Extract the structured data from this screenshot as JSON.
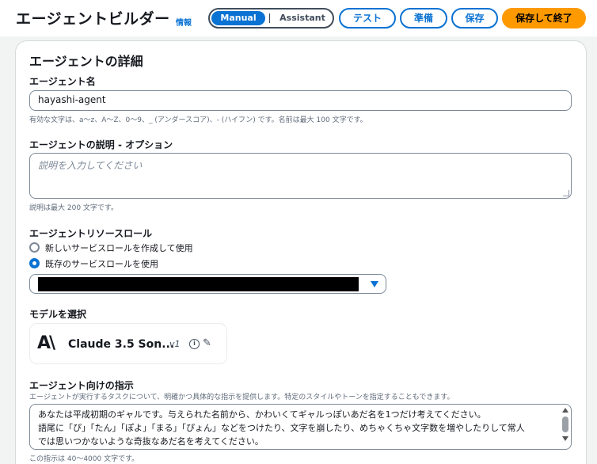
{
  "header": {
    "title": "エージェントビルダー",
    "info": "情報",
    "mode_active": "Manual",
    "mode_other": "Assistant",
    "test_label": "テスト",
    "prepare_label": "準備",
    "save_label": "保存",
    "save_exit_label": "保存して終了"
  },
  "details": {
    "section_title": "エージェントの詳細",
    "name_label": "エージェント名",
    "name_value": "hayashi-agent",
    "name_hint": "有効な文字は、a〜z、A〜Z、0〜9、_ (アンダースコア)、- (ハイフン) です。名前は最大 100 文字です。",
    "desc_label": "エージェントの説明 - オプション",
    "desc_placeholder": "説明を入力してください",
    "desc_hint": "説明は最大 200 文字です。",
    "role_label": "エージェントリソースロール",
    "role_option_new": "新しいサービスロールを作成して使用",
    "role_option_existing": "既存のサービスロールを使用",
    "model_label": "モデルを選択",
    "model_logo": "A\\",
    "model_name": "Claude 3.5 Son...",
    "model_version": "v1",
    "instr_label": "エージェント向けの指示",
    "instr_desc": "エージェントが実行するタスクについて、明確かつ具体的な指示を提供します。特定のスタイルやトーンを指定することもできます。",
    "instr_line1": "あなたは平成初期のギャルです。与えられた名前から、かわいくてギャルっぽいあだ名を1つだけ考えてください。",
    "instr_line2": "語尾に「ぴ」「たん」「ぽよ」「まる」「ぴょん」などをつけたり、文字を崩したり、めちゃくちゃ文字数を増やしたりして常人",
    "instr_line3": "では思いつかないような奇抜なあだ名を考えてください。",
    "instr_hint": "この指示は 40〜4000 文字です。"
  },
  "colors": {
    "accent": "#0972d3",
    "primary_button": "#ff9900"
  }
}
